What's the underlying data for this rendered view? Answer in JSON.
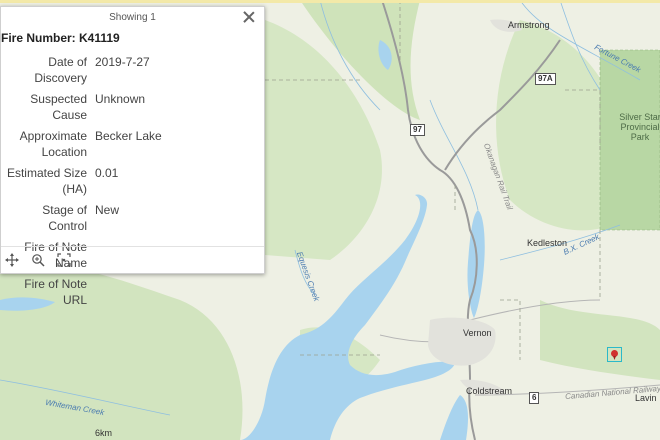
{
  "popup": {
    "showing": "Showing 1",
    "title": "Fire Number: K41119",
    "fields": [
      {
        "label": "Date of Discovery",
        "value": "2019-7-27"
      },
      {
        "label": "Suspected Cause",
        "value": "Unknown"
      },
      {
        "label": "Approximate Location",
        "value": "Becker Lake"
      },
      {
        "label": "Estimated Size (HA)",
        "value": "0.01"
      },
      {
        "label": "Stage of Control",
        "value": "New"
      },
      {
        "label": "Fire of Note Name",
        "value": ""
      },
      {
        "label": "Fire of Note URL",
        "value": ""
      }
    ],
    "tools": [
      "pan-icon",
      "zoom-to-icon",
      "select-area-icon"
    ]
  },
  "map": {
    "places": {
      "armstrong": "Armstrong",
      "kedleston": "Kedleston",
      "vernon": "Vernon",
      "coldstream": "Coldstream",
      "lavington": "Lavin"
    },
    "park": "Silver Star Provincial Park",
    "creeks": {
      "fortune": "Fortune Creek",
      "bx": "B.X. Creek",
      "whiteman": "Whiteman Creek",
      "equesis": "Equesis Creek",
      "railway1": "Okanagan Rail Trail",
      "railway2": "Canadian National Railway"
    },
    "shields": {
      "hwy97": "97",
      "hwy97a": "97A",
      "hwy6": "6"
    },
    "scale": "6km",
    "colors": {
      "water": "#a8d3ee",
      "land": "#eef0e4",
      "forest": "#c9e0b4",
      "park": "#b8d7a4",
      "road": "#8c8c8c",
      "fire": "#d0312d"
    }
  }
}
